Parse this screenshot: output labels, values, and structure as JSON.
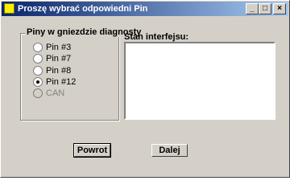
{
  "window": {
    "title": "Proszę wybrać odpowiedni Pin",
    "controls": {
      "minimize": "_",
      "maximize": "□",
      "close": "×"
    }
  },
  "pin_group": {
    "legend": "Piny w gniezdzie diagnosty",
    "options": [
      {
        "label": "Pin #3",
        "checked": false,
        "enabled": true
      },
      {
        "label": "Pin #7",
        "checked": false,
        "enabled": true
      },
      {
        "label": "Pin #8",
        "checked": false,
        "enabled": true
      },
      {
        "label": "Pin #12",
        "checked": true,
        "enabled": true
      },
      {
        "label": "CAN",
        "checked": false,
        "enabled": false
      }
    ]
  },
  "interface_status": {
    "label": "Stan interfejsu:",
    "value": ""
  },
  "buttons": {
    "back": "Powrot",
    "next": "Dalej"
  }
}
